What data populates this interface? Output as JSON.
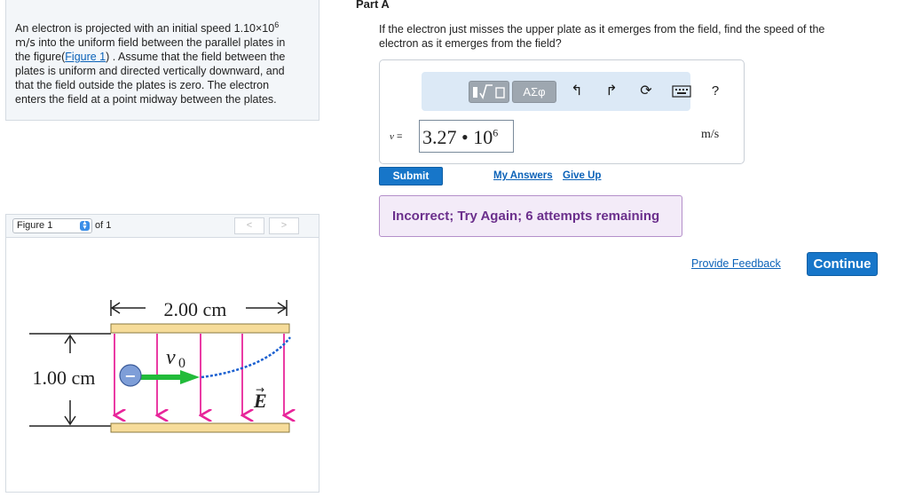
{
  "problem": {
    "line1_a": "An electron is projected with an initial speed 1.10×10",
    "line1_exp": "6",
    "line2_unit": "m/s",
    "line2_rest": " into the uniform field between the parallel plates in",
    "line3_pre": "the figure(",
    "figure_link": "Figure 1",
    "line3_post": ") . Assume that the field between the",
    "line4": "plates is uniform and directed vertically downward, and",
    "line5": "that the field outside the plates is zero. The electron",
    "line6": "enters the field at a point midway between the plates."
  },
  "figure_nav": {
    "select_value": "Figure 1",
    "of_label": "of 1",
    "prev": "<",
    "next": ">"
  },
  "figure": {
    "width_label": "2.00 cm",
    "height_label": "1.00 cm",
    "v0_label": "v",
    "v0_sub": "0",
    "field_label": "E",
    "field_arrow": "→",
    "charge_symbol": "−"
  },
  "part": {
    "title": "Part A",
    "question": "If the electron just misses the upper plate as it emerges from the field, find the speed of the electron as it emerges from the field?"
  },
  "answer": {
    "toolbar_greek": "ΑΣφ",
    "var_label": "v",
    "equals": " =",
    "value_mantissa": "3.27",
    "value_dot": " • ",
    "value_base": "10",
    "value_exp": "6",
    "unit": "m/s",
    "help": "?"
  },
  "actions": {
    "submit": "Submit",
    "my_answers": "My Answers",
    "give_up": "Give Up",
    "feedback": "Incorrect; Try Again; 6 attempts remaining",
    "provide_feedback": "Provide Feedback",
    "continue": "Continue"
  },
  "colors": {
    "link": "#0b62b8",
    "button": "#1776c9",
    "feedback_text": "#6b2f8c",
    "plate": "#f6dc9a",
    "field_line": "#e8259a",
    "velocity": "#22bb3a",
    "path": "#1a5fd0"
  }
}
